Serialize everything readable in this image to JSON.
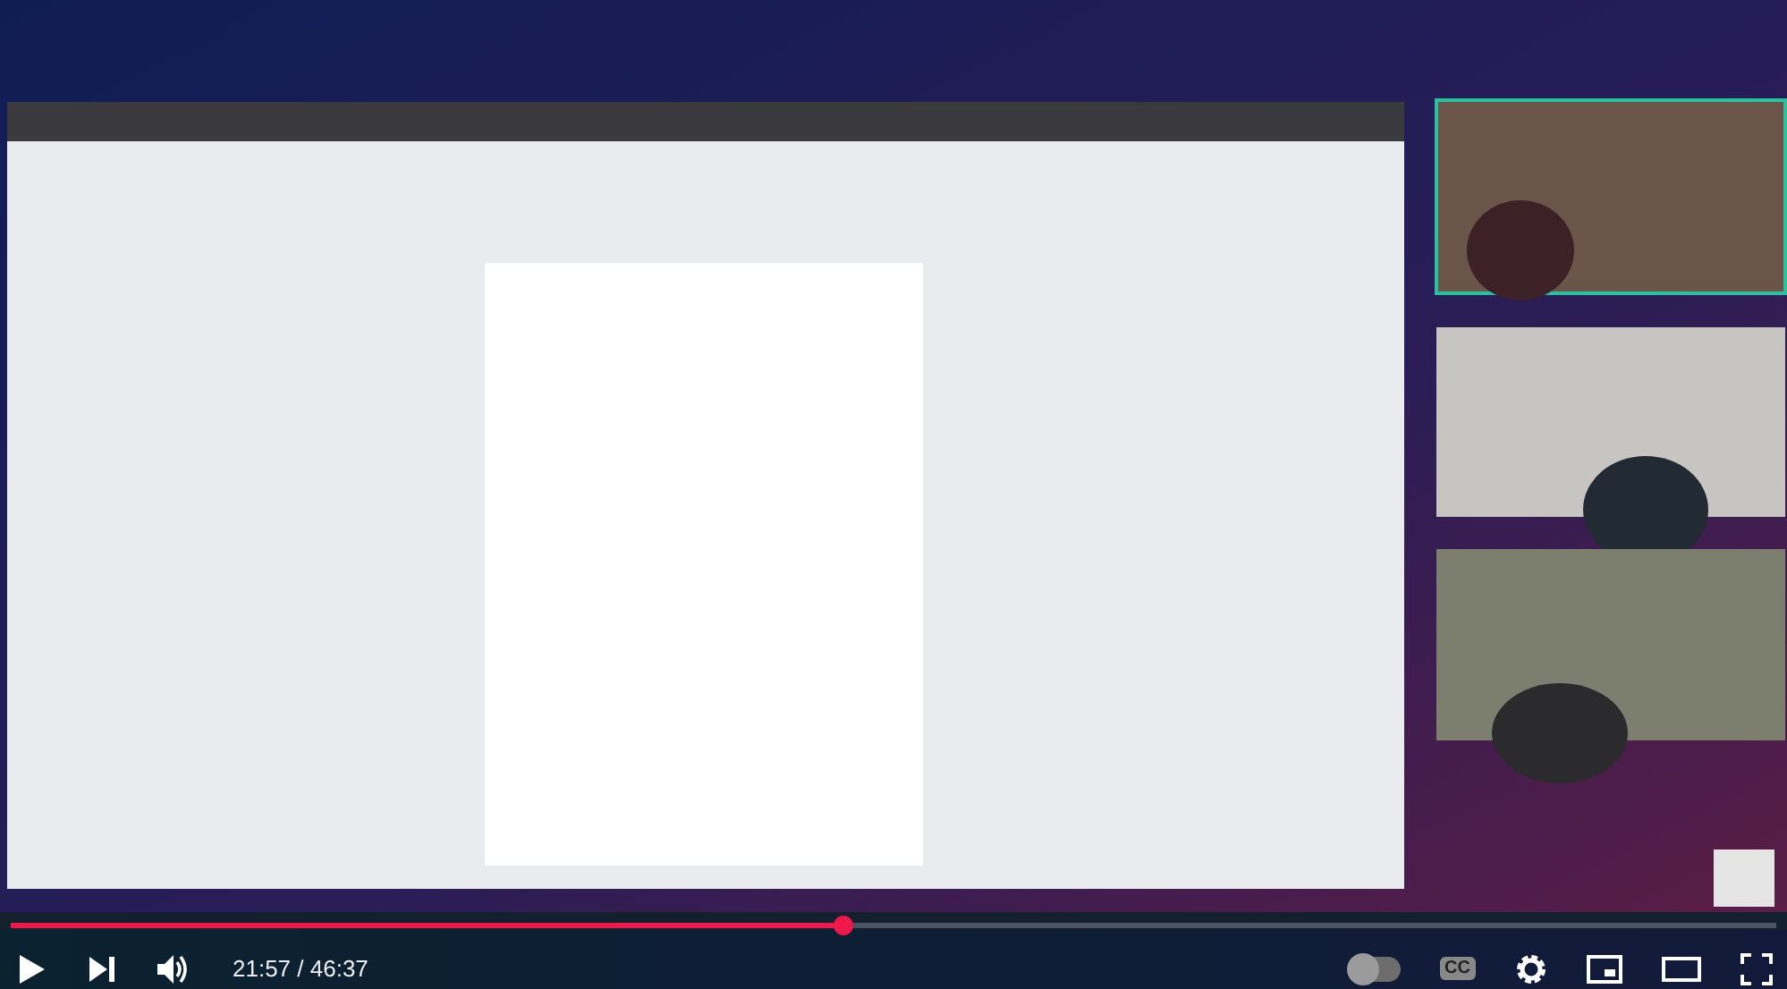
{
  "progress": {
    "level": 0.471
  },
  "controls": {
    "time": "21:57 / 46:37",
    "autoplay": {
      "on": false
    },
    "captions": {
      "label": "CC",
      "on": false
    }
  }
}
